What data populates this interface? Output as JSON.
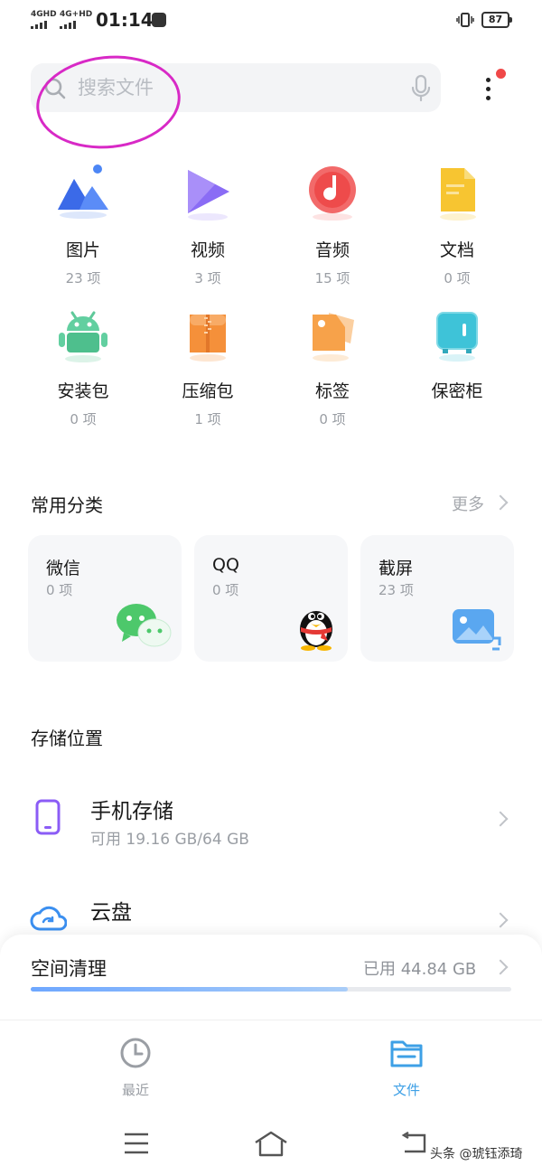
{
  "status_bar": {
    "net1": "4GHD",
    "net2": "4G+HD",
    "time": "01:14",
    "battery": "87"
  },
  "search": {
    "placeholder": "搜索文件",
    "search_icon": "search-icon",
    "mic_icon": "mic-icon",
    "more_icon": "more-vertical-icon"
  },
  "categories": [
    {
      "name": "图片",
      "count": "23 项",
      "icon": "image-icon"
    },
    {
      "name": "视频",
      "count": "3 项",
      "icon": "video-play-icon"
    },
    {
      "name": "音频",
      "count": "15 项",
      "icon": "music-note-icon"
    },
    {
      "name": "文档",
      "count": "0 项",
      "icon": "document-icon"
    },
    {
      "name": "安装包",
      "count": "0 项",
      "icon": "android-icon"
    },
    {
      "name": "压缩包",
      "count": "1 项",
      "icon": "zip-archive-icon"
    },
    {
      "name": "标签",
      "count": "0 项",
      "icon": "tag-icon"
    },
    {
      "name": "保密柜",
      "count": "",
      "icon": "safe-box-icon"
    }
  ],
  "common": {
    "title": "常用分类",
    "more": "更多",
    "cards": [
      {
        "name": "微信",
        "count": "0 项",
        "icon": "wechat-icon"
      },
      {
        "name": "QQ",
        "count": "0 项",
        "icon": "qq-penguin-icon"
      },
      {
        "name": "截屏",
        "count": "23 项",
        "icon": "screenshot-icon"
      }
    ]
  },
  "storage": {
    "title": "存储位置",
    "phone_name": "手机存储",
    "phone_detail": "可用 19.16 GB/64 GB",
    "cloud_name": "云盘"
  },
  "cleanup": {
    "title": "空间清理",
    "used": "已用 44.84 GB",
    "progress": 0.66
  },
  "tabs": [
    {
      "label": "最近",
      "icon": "clock-icon",
      "active": false
    },
    {
      "label": "文件",
      "icon": "folder-icon",
      "active": true
    }
  ],
  "colors": {
    "accent": "#3ea0e6",
    "inactive": "#9a9ea4",
    "annotation": "#d829c6"
  },
  "watermark": "头条 @琥钰添琦"
}
